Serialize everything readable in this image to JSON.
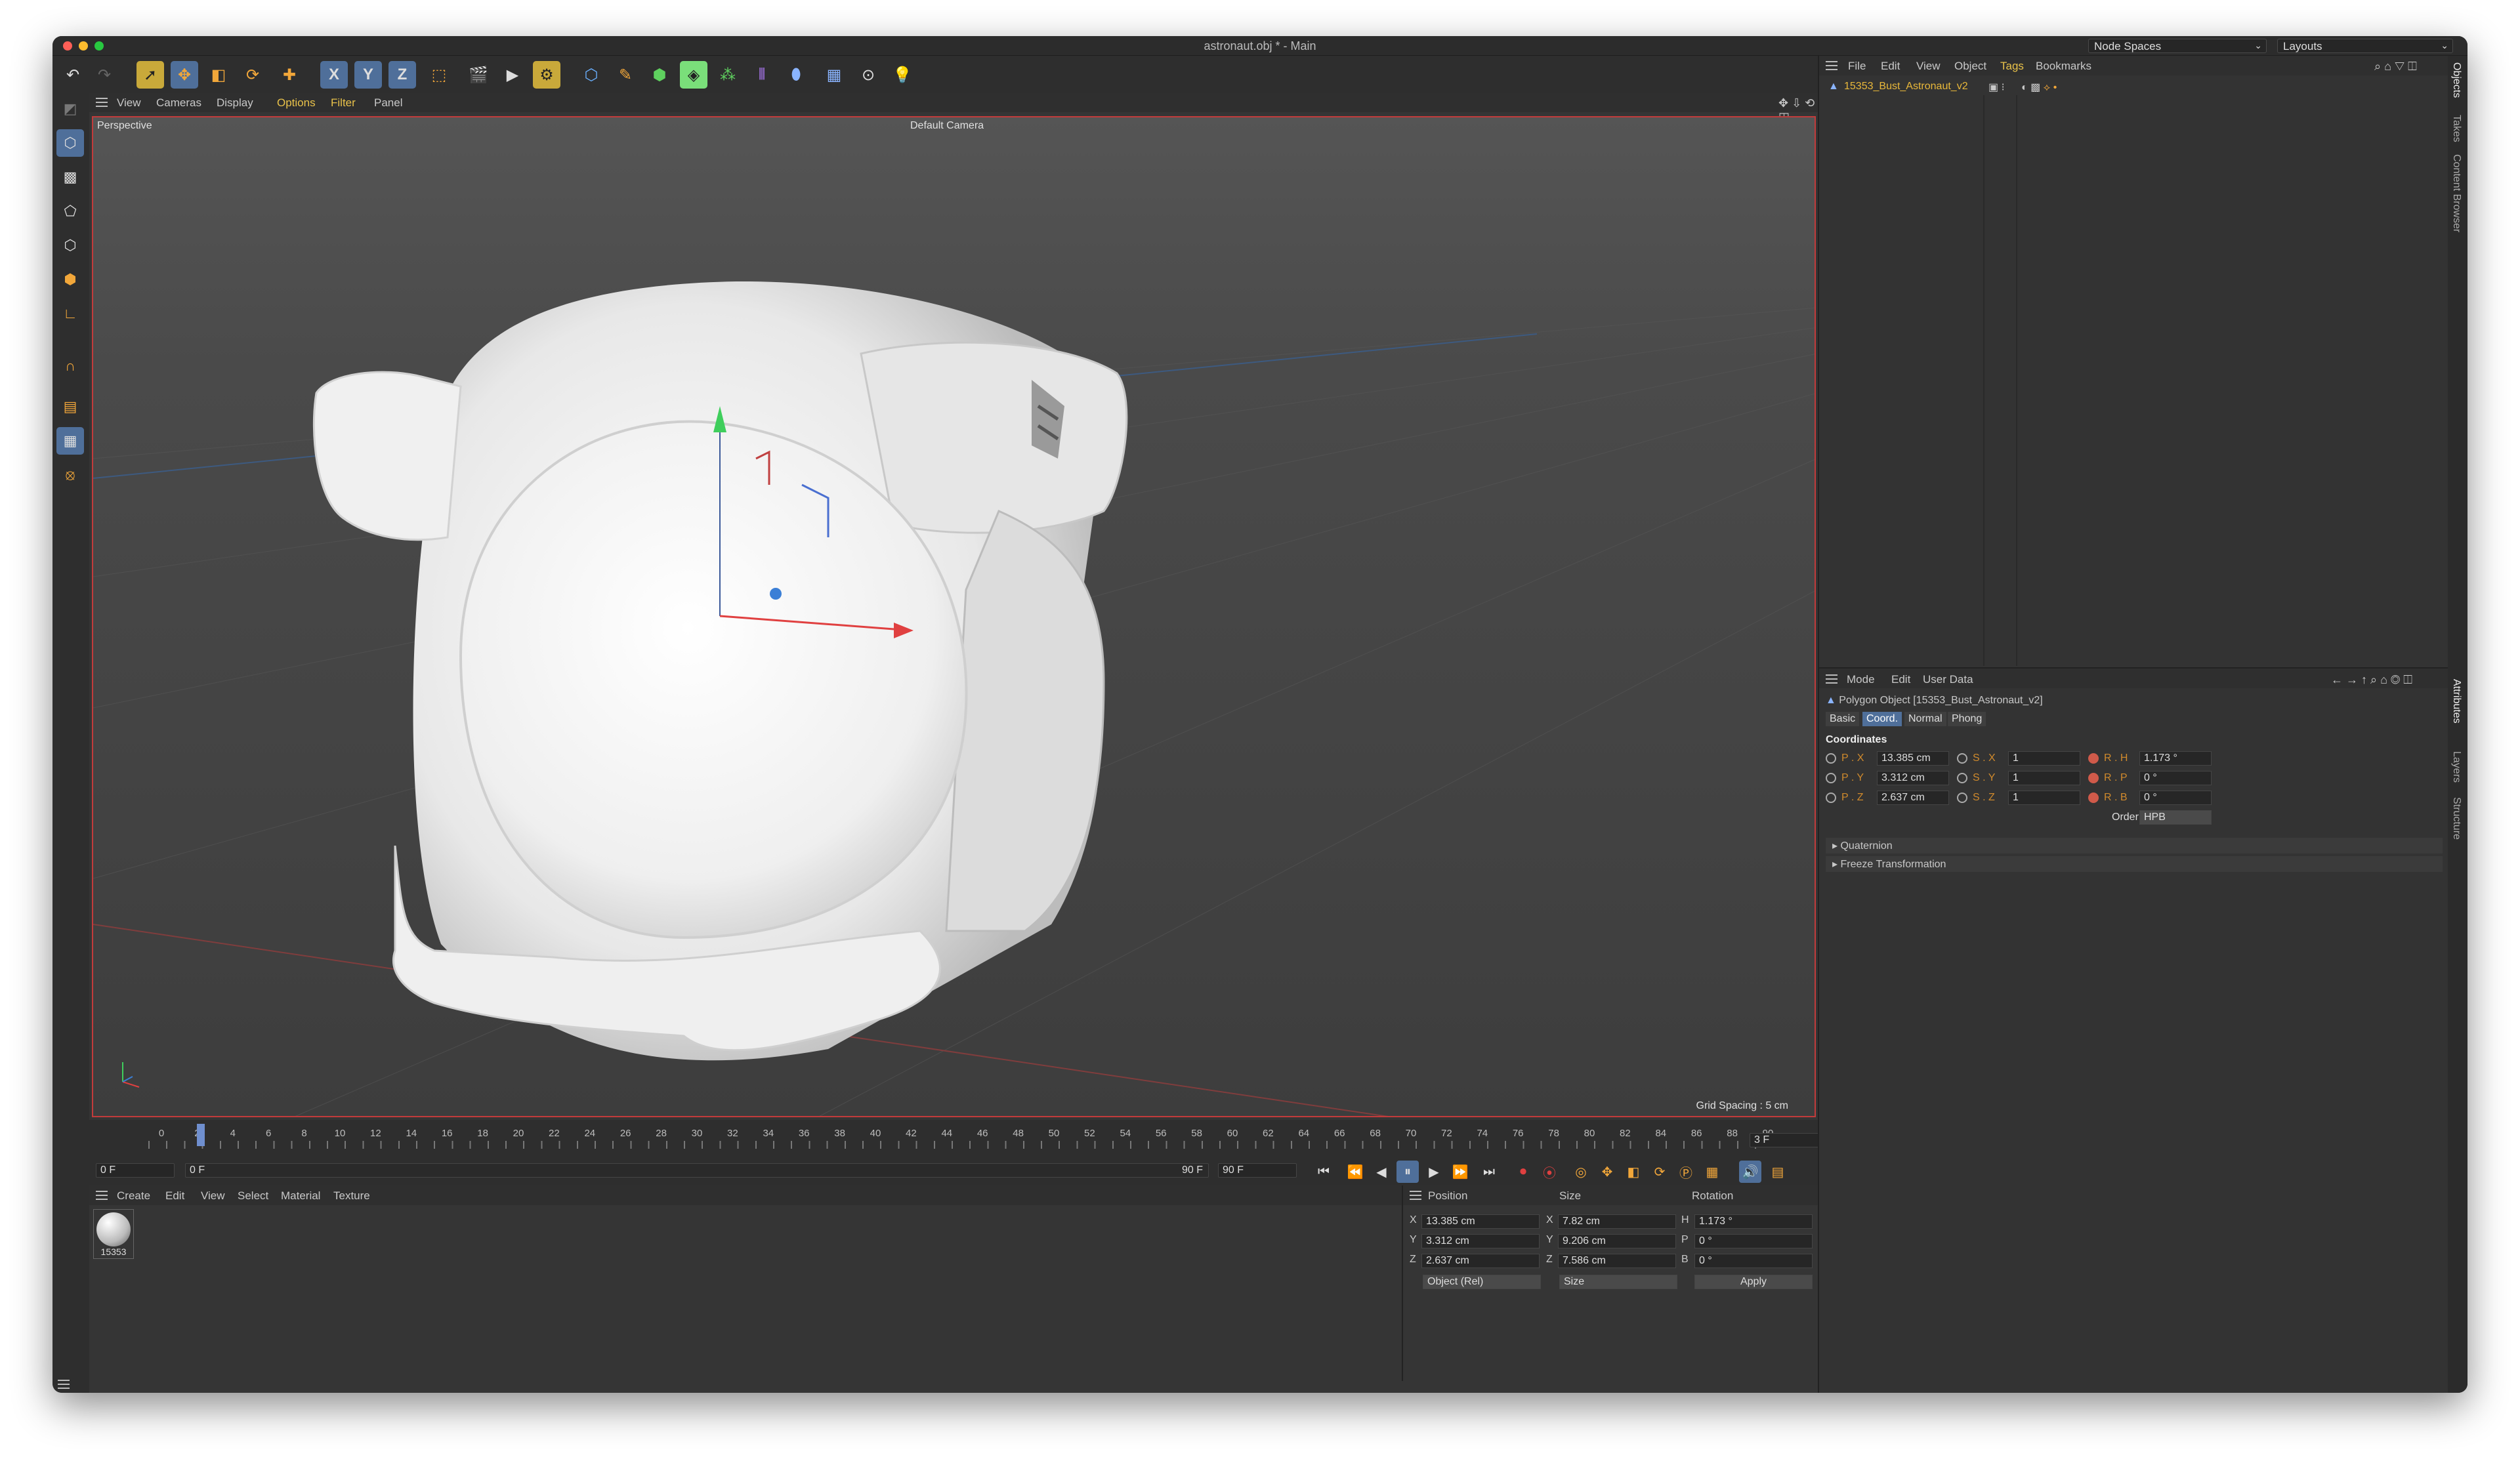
{
  "window": {
    "title": "astronaut.obj * - Main",
    "node_spaces": "Node Spaces",
    "layouts": "Layouts"
  },
  "colors": {
    "accent_active": "#4f6f9a",
    "highlight": "#c9a93a",
    "selection_border": "#c23b3b",
    "orange_label": "#d08a2c"
  },
  "toolbar": {
    "icons": [
      "undo-icon",
      "redo-icon",
      "select-icon",
      "move-icon",
      "scale-icon",
      "rotate-icon",
      "add-icon",
      "x-axis-icon",
      "y-axis-icon",
      "z-axis-icon",
      "coordinate-system-icon",
      "render-view-icon",
      "render-picture-viewer-icon",
      "render-settings-icon",
      "cube-icon",
      "pen-icon",
      "subdivision-icon",
      "generator-icon",
      "cloner-icon",
      "deformer-icon",
      "floor-icon",
      "camera-icon",
      "light-icon"
    ],
    "x": "X",
    "y": "Y",
    "z": "Z"
  },
  "viewport": {
    "menu": [
      "View",
      "Cameras",
      "Display",
      "Options",
      "Filter",
      "Panel"
    ],
    "label": "Perspective",
    "camera": "Default Camera",
    "grid_spacing": "Grid Spacing : 5 cm"
  },
  "timeline": {
    "ticks": [
      "0",
      "2",
      "4",
      "6",
      "8",
      "10",
      "12",
      "14",
      "16",
      "18",
      "20",
      "22",
      "24",
      "26",
      "28",
      "30",
      "32",
      "34",
      "36",
      "38",
      "40",
      "42",
      "44",
      "46",
      "48",
      "50",
      "52",
      "54",
      "56",
      "58",
      "60",
      "62",
      "64",
      "66",
      "68",
      "70",
      "72",
      "74",
      "76",
      "78",
      "80",
      "82",
      "84",
      "86",
      "88",
      "90"
    ],
    "current_frame": "3 F",
    "start": "0 F",
    "range_start": "0 F",
    "range_end": "90 F",
    "end": "90 F"
  },
  "materials": {
    "menu": [
      "Create",
      "Edit",
      "View",
      "Select",
      "Material",
      "Texture"
    ],
    "items": [
      {
        "name": "15353"
      }
    ]
  },
  "coords": {
    "headers": [
      "Position",
      "Size",
      "Rotation"
    ],
    "rows": [
      {
        "a": "X",
        "p": "13.385 cm",
        "b": "X",
        "s": "7.82 cm",
        "c": "H",
        "r": "1.173 °"
      },
      {
        "a": "Y",
        "p": "3.312 cm",
        "b": "Y",
        "s": "9.206 cm",
        "c": "P",
        "r": "0 °"
      },
      {
        "a": "Z",
        "p": "2.637 cm",
        "b": "Z",
        "s": "7.586 cm",
        "c": "B",
        "r": "0 °"
      }
    ],
    "mode": "Object (Rel)",
    "size_mode": "Size",
    "apply": "Apply"
  },
  "objects": {
    "menu": [
      "File",
      "Edit",
      "View",
      "Object",
      "Tags",
      "Bookmarks"
    ],
    "item": "15353_Bust_Astronaut_v2"
  },
  "attributes": {
    "menu": [
      "Mode",
      "Edit",
      "User Data"
    ],
    "title": "Polygon Object [15353_Bust_Astronaut_v2]",
    "tabs": [
      "Basic",
      "Coord.",
      "Normal",
      "Phong"
    ],
    "section": "Coordinates",
    "rows": [
      {
        "pl": "P . X",
        "pv": "13.385 cm",
        "sl": "S . X",
        "sv": "1",
        "rl": "R . H",
        "rv": "1.173 °"
      },
      {
        "pl": "P . Y",
        "pv": "3.312 cm",
        "sl": "S . Y",
        "sv": "1",
        "rl": "R . P",
        "rv": "0 °"
      },
      {
        "pl": "P . Z",
        "pv": "2.637 cm",
        "sl": "S . Z",
        "sv": "1",
        "rl": "R . B",
        "rv": "0 °"
      }
    ],
    "order_label": "Order",
    "order": "HPB",
    "quaternion": "Quaternion",
    "freeze": "Freeze Transformation"
  },
  "side_tabs": [
    "Objects",
    "Takes",
    "Content Browser",
    "Attributes",
    "Layers",
    "Structure"
  ]
}
